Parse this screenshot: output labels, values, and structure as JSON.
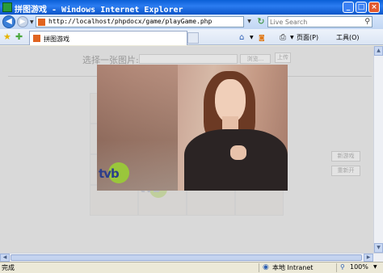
{
  "window": {
    "title": "拼图游戏 - Windows Internet Explorer"
  },
  "toolbar": {
    "back": "◀",
    "forward": "▶",
    "address": "http://localhost/phpdocx/game/playGame.php",
    "search_placeholder": "Live Search",
    "search_icon": "search-icon"
  },
  "tab": {
    "label": "拼图游戏"
  },
  "commands": {
    "page": "页面(P)",
    "tools": "工具(O)"
  },
  "page": {
    "upload_label": "选择一张图片:",
    "browse_button": "浏览...",
    "upload_button": "上传",
    "new_game_button": "新游戏",
    "reset_button": "重新开"
  },
  "photo": {
    "logo_text": "tvb",
    "ghost_logo_text": "tvb"
  },
  "status": {
    "text": "完成",
    "zone": "本地 Intranet",
    "zoom": "100%"
  },
  "colors": {
    "titlebar": "#0a5fd6",
    "logo_green": "#9ac63b",
    "logo_blue": "#2c3e8a"
  }
}
